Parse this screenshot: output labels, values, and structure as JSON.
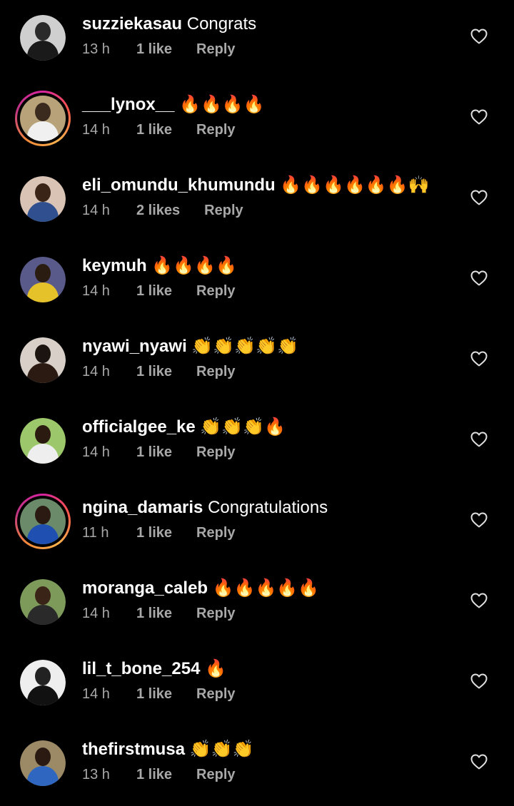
{
  "colors": {
    "background": "#000000",
    "text": "#ffffff",
    "meta": "#a8a8a8",
    "story_ring": "#d6249f"
  },
  "comments": [
    {
      "username": "suzziekasau",
      "text": "Congrats",
      "time": "13 h",
      "likes": "1 like",
      "reply": "Reply",
      "ring": false
    },
    {
      "username": "___lynox__",
      "text": "🔥🔥🔥🔥",
      "time": "14 h",
      "likes": "1 like",
      "reply": "Reply",
      "ring": true
    },
    {
      "username": "eli_omundu_khumundu",
      "text": "🔥🔥🔥🔥🔥🔥🙌",
      "time": "14 h",
      "likes": "2 likes",
      "reply": "Reply",
      "ring": false
    },
    {
      "username": "keymuh",
      "text": "🔥🔥🔥🔥",
      "time": "14 h",
      "likes": "1 like",
      "reply": "Reply",
      "ring": false
    },
    {
      "username": "nyawi_nyawi",
      "text": "👏👏👏👏👏",
      "time": "14 h",
      "likes": "1 like",
      "reply": "Reply",
      "ring": false
    },
    {
      "username": "officialgee_ke",
      "text": "👏👏👏🔥",
      "time": "14 h",
      "likes": "1 like",
      "reply": "Reply",
      "ring": false
    },
    {
      "username": "ngina_damaris",
      "text": "Congratulations",
      "time": "11 h",
      "likes": "1 like",
      "reply": "Reply",
      "ring": true
    },
    {
      "username": "moranga_caleb",
      "text": "🔥🔥🔥🔥🔥",
      "time": "14 h",
      "likes": "1 like",
      "reply": "Reply",
      "ring": false
    },
    {
      "username": "lil_t_bone_254",
      "text": "🔥",
      "time": "14 h",
      "likes": "1 like",
      "reply": "Reply",
      "ring": false
    },
    {
      "username": "thefirstmusa",
      "text": "👏👏👏",
      "time": "13 h",
      "likes": "1 like",
      "reply": "Reply",
      "ring": false
    }
  ],
  "icons": {
    "like": "heart-outline-icon"
  }
}
